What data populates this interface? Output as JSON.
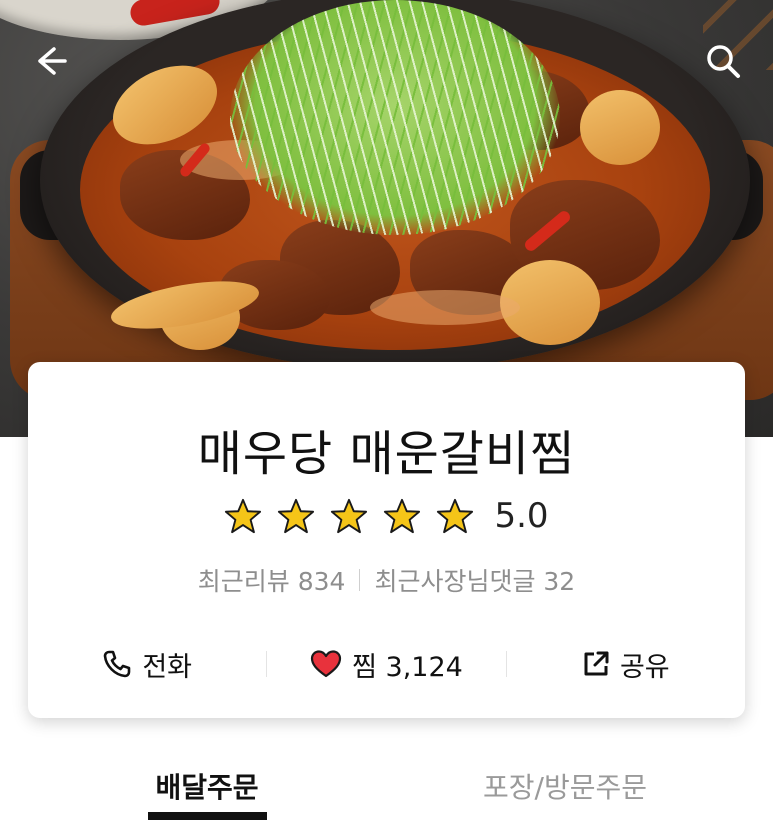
{
  "restaurant": {
    "name": "매우당 매운갈비찜",
    "rating": "5.0",
    "stars_filled": 5,
    "stars_total": 5
  },
  "reviews": {
    "recent_reviews": "최근리뷰 834",
    "owner_replies": "최근사장님댓글 32"
  },
  "actions": {
    "call": "전화",
    "favorite": "찜 3,124",
    "share": "공유"
  },
  "tabs": {
    "delivery": "배달주문",
    "pickup": "포장/방문주문",
    "active": "delivery"
  },
  "icons": {
    "back": "back-arrow-icon",
    "search": "search-icon",
    "star": "star-icon",
    "phone": "phone-icon",
    "heart": "heart-icon",
    "share": "share-icon"
  },
  "colors": {
    "star": "#f5c518",
    "heart": "#e8323c",
    "text": "#111111",
    "muted": "#8e8e8e"
  }
}
